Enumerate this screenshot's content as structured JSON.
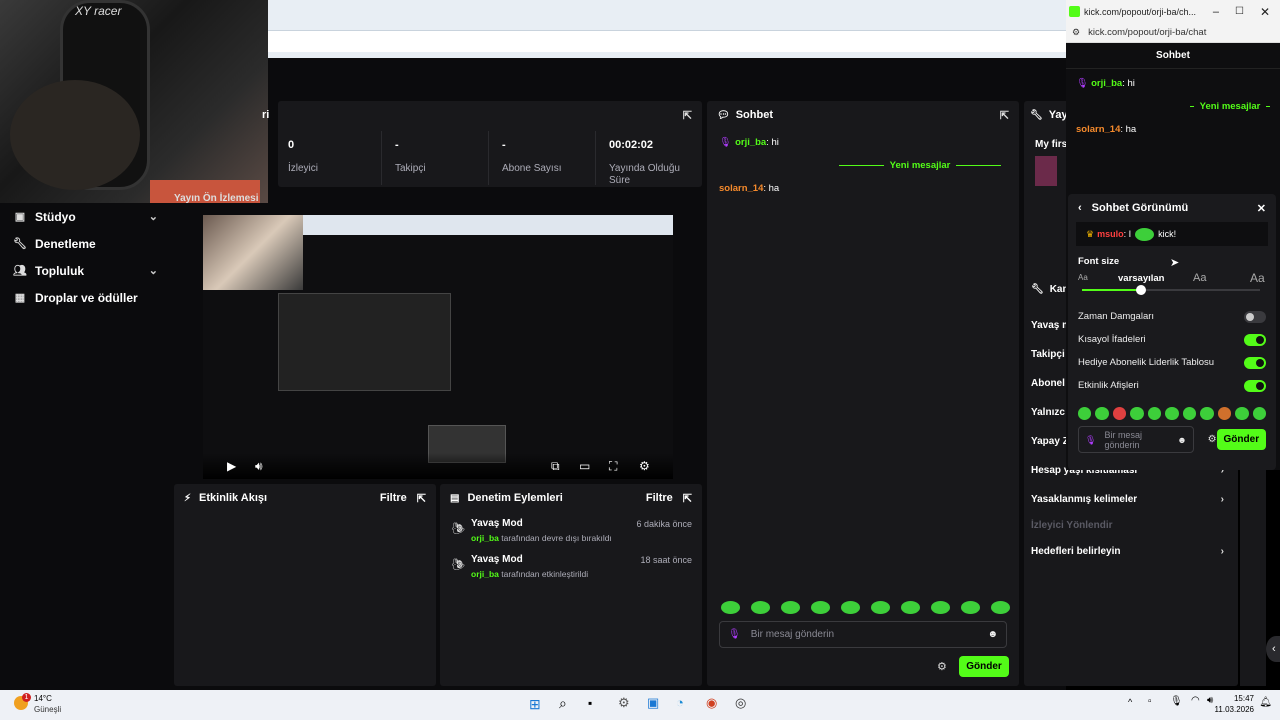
{
  "webcam": {
    "logo": "XY racer"
  },
  "sidebar": {
    "items": [
      {
        "label": "Stüdyo",
        "icon": "studio-icon",
        "chevron": true
      },
      {
        "label": "Denetleme",
        "icon": "wrench-icon",
        "chevron": false
      },
      {
        "label": "Topluluk",
        "icon": "community-icon",
        "chevron": true
      },
      {
        "label": "Droplar ve ödüller",
        "icon": "gift-icon",
        "chevron": false
      }
    ]
  },
  "stats": {
    "header": "ri",
    "items": [
      {
        "value": "0",
        "label": "İzleyici"
      },
      {
        "value": "-",
        "label": "Takipçi"
      },
      {
        "value": "-",
        "label": "Abone Sayısı"
      },
      {
        "value": "00:02:02",
        "label": "Yayında Olduğu Süre"
      }
    ]
  },
  "preview": {
    "header": "Yayın Ön İzlemesi"
  },
  "activity": {
    "title": "Etkinlik Akışı",
    "filter": "Filtre"
  },
  "modlog": {
    "title": "Denetim Eylemleri",
    "filter": "Filtre",
    "entries": [
      {
        "title": "Yavaş Mod",
        "time": "6 dakika önce",
        "user": "orji_ba",
        "desc": " tarafından devre dışı bırakıldı"
      },
      {
        "title": "Yavaş Mod",
        "time": "18 saat önce",
        "user": "orji_ba",
        "desc": " tarafından etkinleştirildi"
      }
    ]
  },
  "chat": {
    "title": "Sohbet",
    "messages": [
      {
        "user": "orji_ba",
        "text": ": hi",
        "color": "#53fc18"
      },
      {
        "user": "solarn_14",
        "text": ": ha",
        "color": "#f58a2c"
      }
    ],
    "new_messages": "Yeni mesajlar",
    "placeholder": "Bir mesaj gönderin",
    "send": "Gönder"
  },
  "right_panel": {
    "title": "Yayı",
    "stream_title": "My firs",
    "section": "Kan",
    "items": [
      {
        "label": "Yavaş m",
        "chev": false
      },
      {
        "label": "Takipçi",
        "chev": false
      },
      {
        "label": "Abonel",
        "chev": false
      },
      {
        "label": "Yalnızc",
        "chev": false
      },
      {
        "label": "Yapay Z",
        "chev": false
      },
      {
        "label": "Hesap yaşı kısıtlaması",
        "chev": true
      },
      {
        "label": "Yasaklanmış kelimeler",
        "chev": true
      },
      {
        "label": "İzleyici Yönlendir",
        "chev": false,
        "muted": true
      },
      {
        "label": "Hedefleri belirleyin",
        "chev": true
      }
    ]
  },
  "popout": {
    "tab_title": "kick.com/popout/orji-ba/ch...",
    "url": "kick.com/popout/orji-ba/chat",
    "header": "Sohbet",
    "messages": [
      {
        "user": "orji_ba",
        "text": ": hi",
        "color": "#53fc18"
      },
      {
        "user": "solarn_14",
        "text": ": ha",
        "color": "#f58a2c"
      }
    ],
    "new_messages": "Yeni mesajlar",
    "settings": {
      "title": "Sohbet Görünümü",
      "preview_user": "msulo",
      "preview_text": ": I",
      "preview_emote_text": "kick!",
      "font_size_label": "Font size",
      "font_size_value": "varsayılan",
      "font_small": "Aa",
      "font_mid": "Aa",
      "font_large": "Aa",
      "font_level": 0.33,
      "toggles": [
        {
          "label": "Zaman Damgaları",
          "on": false
        },
        {
          "label": "Kısayol İfadeleri",
          "on": true
        },
        {
          "label": "Hediye Abonelik Liderlik Tablosu",
          "on": true
        },
        {
          "label": "Etkinlik Afişleri",
          "on": true
        }
      ],
      "placeholder": "Bir mesaj gönderin",
      "send": "Gönder"
    }
  },
  "taskbar": {
    "temp": "14°C",
    "weather": "Güneşli",
    "time": "15:47",
    "date": "11.03.2026",
    "badge": "1"
  }
}
